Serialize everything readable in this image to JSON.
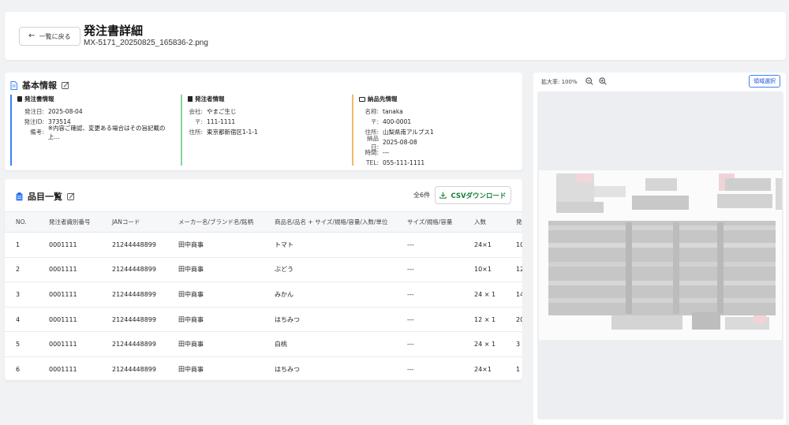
{
  "header": {
    "back_label": "一覧に戻る",
    "title": "発注書詳細",
    "file_name": "MX-5171_20250825_165836-2.png"
  },
  "basic": {
    "title": "基本情報",
    "order": {
      "heading": "発注書情報",
      "rows": [
        {
          "label": "発注日:",
          "value": "2025-08-04"
        },
        {
          "label": "発注ID:",
          "value": "373514"
        },
        {
          "label": "備考:",
          "value": "※内容ご確認、変更ある場合はその旨記載の上…"
        }
      ]
    },
    "orderer": {
      "heading": "発注者情報",
      "rows": [
        {
          "label": "会社:",
          "value": "やまご生じ"
        },
        {
          "label": "〒:",
          "value": "111-1111"
        },
        {
          "label": "住所:",
          "value": "東京都新宿区1-1-1"
        }
      ]
    },
    "delivery": {
      "heading": "納品先情報",
      "rows": [
        {
          "label": "名称:",
          "value": "tanaka"
        },
        {
          "label": "〒:",
          "value": "400-0001"
        },
        {
          "label": "住所:",
          "value": "山梨県南アルプス1"
        },
        {
          "label": "納品日:",
          "value": "2025-08-08"
        },
        {
          "label": "時間:",
          "value": "---"
        },
        {
          "label": "TEL:",
          "value": "055-111-1111"
        }
      ]
    }
  },
  "items": {
    "title": "品目一覧",
    "count": "全6件",
    "csv_label": "CSVダウンロード",
    "columns": [
      "NO.",
      "発注者識別番号",
      "JANコード",
      "メーカー名/ブランド名/銘柄",
      "商品名/品名 + サイズ/規格/容量/入数/単位",
      "サイズ/規格/容量",
      "入数",
      "発"
    ],
    "rows": [
      [
        "1",
        "0001111",
        "21244448899",
        "田中商事",
        "トマト",
        "---",
        "24×1",
        "10"
      ],
      [
        "2",
        "0001111",
        "21244448899",
        "田中商事",
        "ぶどう",
        "---",
        "10×1",
        "12"
      ],
      [
        "3",
        "0001111",
        "21244448899",
        "田中商事",
        "みかん",
        "---",
        "24 × 1",
        "14"
      ],
      [
        "4",
        "0001111",
        "21244448899",
        "田中商事",
        "はちみつ",
        "---",
        "12 × 1",
        "20"
      ],
      [
        "5",
        "0001111",
        "21244448899",
        "田中商事",
        "白桃",
        "---",
        "24 × 1",
        "3"
      ],
      [
        "6",
        "0001111",
        "21244448899",
        "田中商事",
        "はちみつ",
        "---",
        "24×1",
        "1"
      ]
    ]
  },
  "preview": {
    "zoom_label": "拡大率: 100%",
    "area_select_label": "領域選択"
  },
  "colors": {
    "accent_blue": "#3b82f6",
    "green": "#16803c",
    "order_border": "#3b82f6",
    "orderer_border": "#86d49b",
    "delivery_border": "#f5b66a"
  }
}
